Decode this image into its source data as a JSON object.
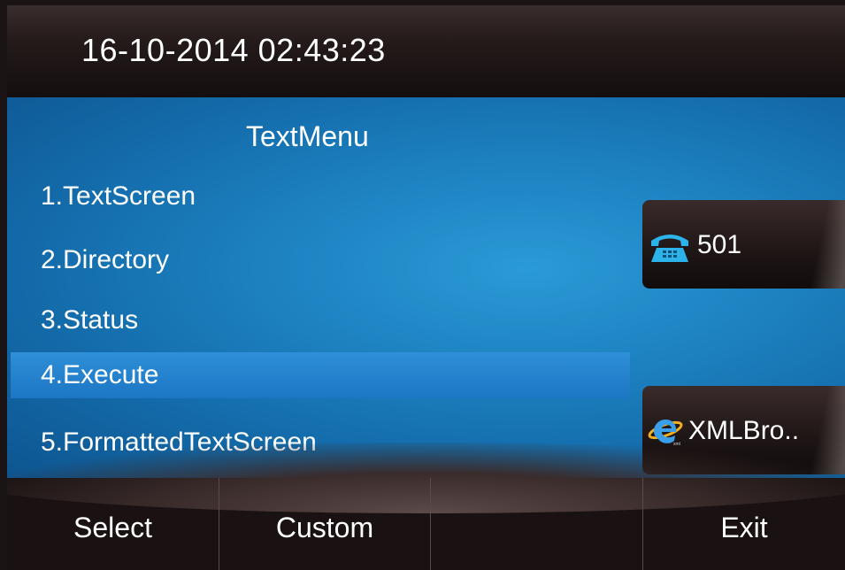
{
  "status_bar": {
    "datetime": "16-10-2014 02:43:23"
  },
  "menu": {
    "title": "TextMenu",
    "items": [
      {
        "label": "1.TextScreen",
        "selected": false
      },
      {
        "label": "2.Directory",
        "selected": false
      },
      {
        "label": "3.Status",
        "selected": false
      },
      {
        "label": "4.Execute",
        "selected": true
      },
      {
        "label": "5.FormattedTextScreen",
        "selected": false
      }
    ]
  },
  "line_keys": [
    {
      "icon": "phone-icon",
      "label": "501"
    },
    {
      "icon": "browser-icon",
      "label": "XMLBro.."
    }
  ],
  "softkeys": [
    {
      "label": "Select"
    },
    {
      "label": "Custom"
    },
    {
      "label": ""
    },
    {
      "label": "Exit"
    }
  ],
  "colors": {
    "screen_blue": "#1f85c4",
    "selection_blue": "#1c76c4",
    "bar_dark": "#1a1212",
    "phone_icon_blue": "#2bb3ea"
  }
}
